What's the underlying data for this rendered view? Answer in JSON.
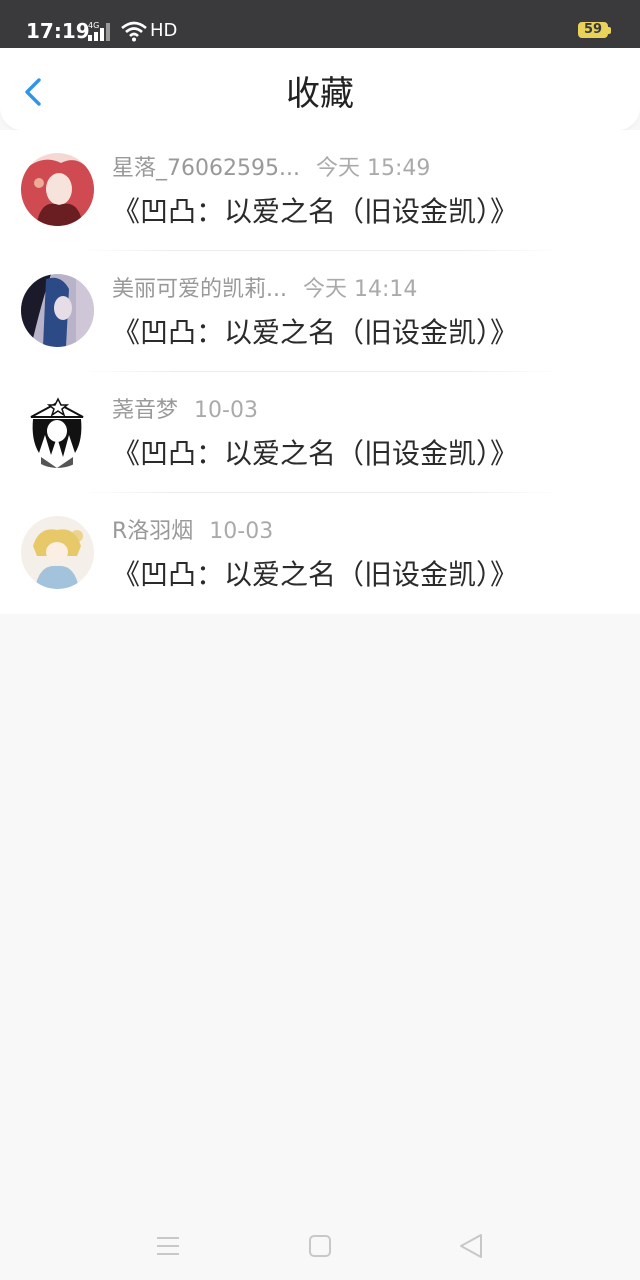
{
  "status_bar": {
    "time": "17:19",
    "network": "4G",
    "hd": "HD",
    "battery": "59",
    "icons": [
      "signal-icon",
      "wifi-icon",
      "battery-icon"
    ]
  },
  "nav": {
    "title": "收藏",
    "back_icon": "chevron-left-icon",
    "accent": "#2f95e8"
  },
  "favorites": [
    {
      "user": "星落_76062595...",
      "time": "今天 15:49",
      "title": "《凹凸：以爱之名（旧设金凯）》",
      "avatar_colors": [
        "#f3d9d4",
        "#c8303a",
        "#6b1e22"
      ]
    },
    {
      "user": "美丽可爱的凯莉...",
      "time": "今天 14:14",
      "title": "《凹凸：以爱之名（旧设金凯）》",
      "avatar_colors": [
        "#b9b3c9",
        "#2b4a86",
        "#1a1a2a"
      ]
    },
    {
      "user": "荛音梦",
      "time": "10-03",
      "title": "《凹凸：以爱之名（旧设金凯）》",
      "avatar_colors": [
        "#ffffff",
        "#111111",
        "#555555"
      ]
    },
    {
      "user": "R洛羽烟",
      "time": "10-03",
      "title": "《凹凸：以爱之名（旧设金凯）》",
      "avatar_colors": [
        "#f4efe8",
        "#e8c96a",
        "#8fb6d8"
      ]
    }
  ],
  "system_nav": {
    "icons": [
      "menu-icon",
      "home-icon",
      "back-triangle-icon"
    ]
  }
}
